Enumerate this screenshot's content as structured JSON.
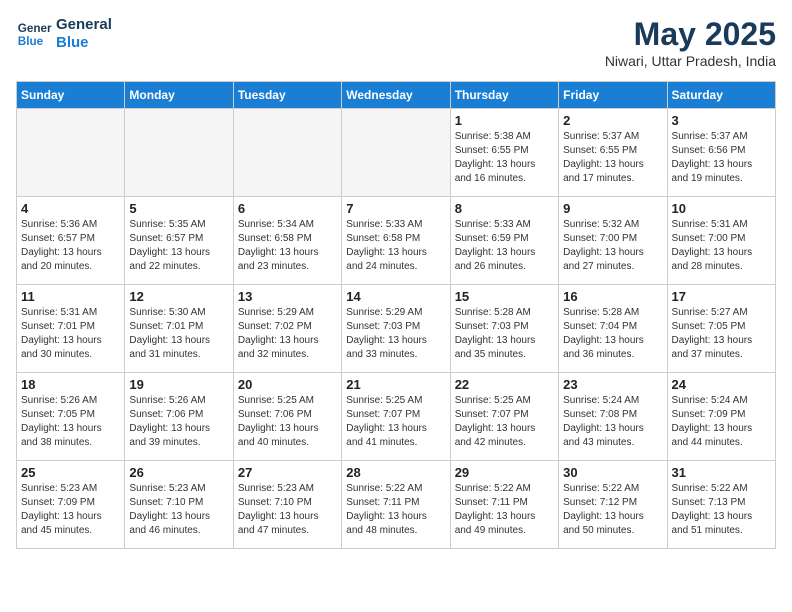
{
  "logo": {
    "line1": "General",
    "line2": "Blue"
  },
  "title": "May 2025",
  "location": "Niwari, Uttar Pradesh, India",
  "days_header": [
    "Sunday",
    "Monday",
    "Tuesday",
    "Wednesday",
    "Thursday",
    "Friday",
    "Saturday"
  ],
  "weeks": [
    [
      {
        "num": "",
        "empty": true
      },
      {
        "num": "",
        "empty": true
      },
      {
        "num": "",
        "empty": true
      },
      {
        "num": "",
        "empty": true
      },
      {
        "num": "1",
        "info": "Sunrise: 5:38 AM\nSunset: 6:55 PM\nDaylight: 13 hours\nand 16 minutes."
      },
      {
        "num": "2",
        "info": "Sunrise: 5:37 AM\nSunset: 6:55 PM\nDaylight: 13 hours\nand 17 minutes."
      },
      {
        "num": "3",
        "info": "Sunrise: 5:37 AM\nSunset: 6:56 PM\nDaylight: 13 hours\nand 19 minutes."
      }
    ],
    [
      {
        "num": "4",
        "info": "Sunrise: 5:36 AM\nSunset: 6:57 PM\nDaylight: 13 hours\nand 20 minutes."
      },
      {
        "num": "5",
        "info": "Sunrise: 5:35 AM\nSunset: 6:57 PM\nDaylight: 13 hours\nand 22 minutes."
      },
      {
        "num": "6",
        "info": "Sunrise: 5:34 AM\nSunset: 6:58 PM\nDaylight: 13 hours\nand 23 minutes."
      },
      {
        "num": "7",
        "info": "Sunrise: 5:33 AM\nSunset: 6:58 PM\nDaylight: 13 hours\nand 24 minutes."
      },
      {
        "num": "8",
        "info": "Sunrise: 5:33 AM\nSunset: 6:59 PM\nDaylight: 13 hours\nand 26 minutes."
      },
      {
        "num": "9",
        "info": "Sunrise: 5:32 AM\nSunset: 7:00 PM\nDaylight: 13 hours\nand 27 minutes."
      },
      {
        "num": "10",
        "info": "Sunrise: 5:31 AM\nSunset: 7:00 PM\nDaylight: 13 hours\nand 28 minutes."
      }
    ],
    [
      {
        "num": "11",
        "info": "Sunrise: 5:31 AM\nSunset: 7:01 PM\nDaylight: 13 hours\nand 30 minutes."
      },
      {
        "num": "12",
        "info": "Sunrise: 5:30 AM\nSunset: 7:01 PM\nDaylight: 13 hours\nand 31 minutes."
      },
      {
        "num": "13",
        "info": "Sunrise: 5:29 AM\nSunset: 7:02 PM\nDaylight: 13 hours\nand 32 minutes."
      },
      {
        "num": "14",
        "info": "Sunrise: 5:29 AM\nSunset: 7:03 PM\nDaylight: 13 hours\nand 33 minutes."
      },
      {
        "num": "15",
        "info": "Sunrise: 5:28 AM\nSunset: 7:03 PM\nDaylight: 13 hours\nand 35 minutes."
      },
      {
        "num": "16",
        "info": "Sunrise: 5:28 AM\nSunset: 7:04 PM\nDaylight: 13 hours\nand 36 minutes."
      },
      {
        "num": "17",
        "info": "Sunrise: 5:27 AM\nSunset: 7:05 PM\nDaylight: 13 hours\nand 37 minutes."
      }
    ],
    [
      {
        "num": "18",
        "info": "Sunrise: 5:26 AM\nSunset: 7:05 PM\nDaylight: 13 hours\nand 38 minutes."
      },
      {
        "num": "19",
        "info": "Sunrise: 5:26 AM\nSunset: 7:06 PM\nDaylight: 13 hours\nand 39 minutes."
      },
      {
        "num": "20",
        "info": "Sunrise: 5:25 AM\nSunset: 7:06 PM\nDaylight: 13 hours\nand 40 minutes."
      },
      {
        "num": "21",
        "info": "Sunrise: 5:25 AM\nSunset: 7:07 PM\nDaylight: 13 hours\nand 41 minutes."
      },
      {
        "num": "22",
        "info": "Sunrise: 5:25 AM\nSunset: 7:07 PM\nDaylight: 13 hours\nand 42 minutes."
      },
      {
        "num": "23",
        "info": "Sunrise: 5:24 AM\nSunset: 7:08 PM\nDaylight: 13 hours\nand 43 minutes."
      },
      {
        "num": "24",
        "info": "Sunrise: 5:24 AM\nSunset: 7:09 PM\nDaylight: 13 hours\nand 44 minutes."
      }
    ],
    [
      {
        "num": "25",
        "info": "Sunrise: 5:23 AM\nSunset: 7:09 PM\nDaylight: 13 hours\nand 45 minutes."
      },
      {
        "num": "26",
        "info": "Sunrise: 5:23 AM\nSunset: 7:10 PM\nDaylight: 13 hours\nand 46 minutes."
      },
      {
        "num": "27",
        "info": "Sunrise: 5:23 AM\nSunset: 7:10 PM\nDaylight: 13 hours\nand 47 minutes."
      },
      {
        "num": "28",
        "info": "Sunrise: 5:22 AM\nSunset: 7:11 PM\nDaylight: 13 hours\nand 48 minutes."
      },
      {
        "num": "29",
        "info": "Sunrise: 5:22 AM\nSunset: 7:11 PM\nDaylight: 13 hours\nand 49 minutes."
      },
      {
        "num": "30",
        "info": "Sunrise: 5:22 AM\nSunset: 7:12 PM\nDaylight: 13 hours\nand 50 minutes."
      },
      {
        "num": "31",
        "info": "Sunrise: 5:22 AM\nSunset: 7:13 PM\nDaylight: 13 hours\nand 51 minutes."
      }
    ]
  ]
}
